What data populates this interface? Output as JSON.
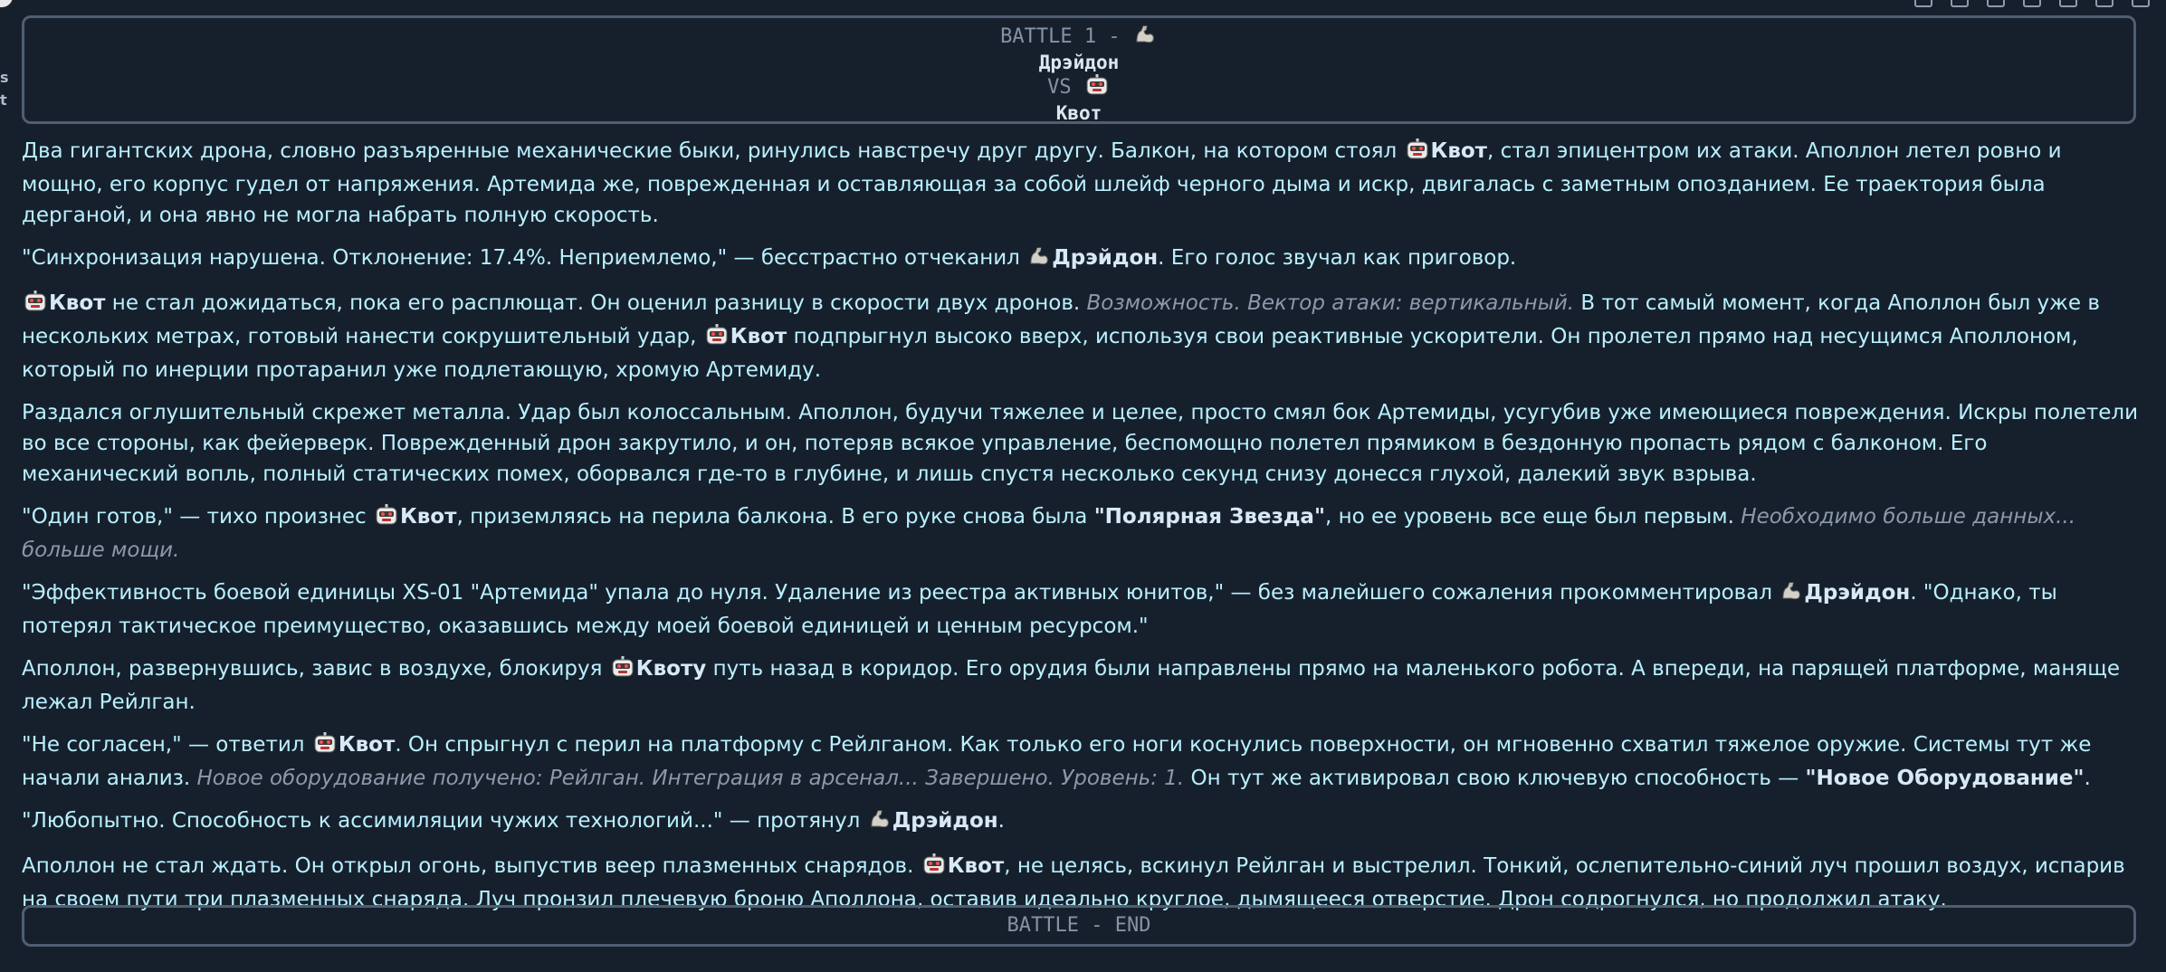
{
  "left_fragments": [
    "s",
    "t"
  ],
  "header": {
    "title": "BATTLE 1 -",
    "fighter_1": "Дрэйдон",
    "vs": "VS",
    "fighter_2": "Квот"
  },
  "footer_label": "BATTLE - END",
  "icons": {
    "muscle": "flexed-biceps-icon",
    "robot": "robot-face-icon"
  },
  "paragraphs": [
    [
      {
        "t": "Два гигантских дрона, словно разъяренные механические быки, ринулись навстречу друг другу. Балкон, на котором стоял "
      },
      {
        "icon": "robot"
      },
      {
        "t": "Квот",
        "s": "b"
      },
      {
        "t": ", стал эпицентром их атаки. Аполлон летел ровно и мощно, его корпус гудел от напряжения. Артемида же, поврежденная и оставляющая за собой шлейф черного дыма и искр, двигалась с заметным опозданием. Ее траектория была дерганой, и она явно не могла набрать полную скорость."
      }
    ],
    [
      {
        "t": "\"Синхронизация нарушена. Отклонение: 17.4%. Неприемлемо,\" — бесстрастно отчеканил "
      },
      {
        "icon": "muscle"
      },
      {
        "t": "Дрэйдон",
        "s": "b"
      },
      {
        "t": ". Его голос звучал как приговор."
      }
    ],
    [
      {
        "icon": "robot"
      },
      {
        "t": "Квот",
        "s": "b"
      },
      {
        "t": " не стал дожидаться, пока его расплющат. Он оценил разницу в скорости двух дронов. "
      },
      {
        "t": "Возможность. Вектор атаки: вертикальный.",
        "s": "i"
      },
      {
        "t": " В тот самый момент, когда Аполлон был уже в нескольких метрах, готовый нанести сокрушительный удар, "
      },
      {
        "icon": "robot"
      },
      {
        "t": "Квот",
        "s": "b"
      },
      {
        "t": " подпрыгнул высоко вверх, используя свои реактивные ускорители. Он пролетел прямо над несущимся Аполлоном, который по инерции протаранил уже подлетающую, хромую Артемиду."
      }
    ],
    [
      {
        "t": "Раздался оглушительный скрежет металла. Удар был колоссальным. Аполлон, будучи тяжелее и целее, просто смял бок Артемиды, усугубив уже имеющиеся повреждения. Искры полетели во все стороны, как фейерверк. Поврежденный дрон закрутило, и он, потеряв всякое управление, беспомощно полетел прямиком в бездонную пропасть рядом с балконом. Его механический вопль, полный статических помех, оборвался где-то в глубине, и лишь спустя несколько секунд снизу донесся глухой, далекий звук взрыва."
      }
    ],
    [
      {
        "t": "\"Один готов,\" — тихо произнес "
      },
      {
        "icon": "robot"
      },
      {
        "t": "Квот",
        "s": "b"
      },
      {
        "t": ", приземляясь на перила балкона. В его руке снова была "
      },
      {
        "t": "\"Полярная Звезда\"",
        "s": "b"
      },
      {
        "t": ", но ее уровень все еще был первым. "
      },
      {
        "t": "Необходимо больше данных... больше мощи.",
        "s": "i"
      }
    ],
    [
      {
        "t": "\"Эффективность боевой единицы XS-01 \"Артемида\" упала до нуля. Удаление из реестра активных юнитов,\" — без малейшего сожаления прокомментировал "
      },
      {
        "icon": "muscle"
      },
      {
        "t": "Дрэйдон",
        "s": "b"
      },
      {
        "t": ". \"Однако, ты потерял тактическое преимущество, оказавшись между моей боевой единицей и ценным ресурсом.\""
      }
    ],
    [
      {
        "t": "Аполлон, развернувшись, завис в воздухе, блокируя "
      },
      {
        "icon": "robot"
      },
      {
        "t": "Квоту",
        "s": "b"
      },
      {
        "t": " путь назад в коридор. Его орудия были направлены прямо на маленького робота. А впереди, на парящей платформе, маняще лежал Рейлган."
      }
    ],
    [
      {
        "t": "\"Не согласен,\" — ответил "
      },
      {
        "icon": "robot"
      },
      {
        "t": "Квот",
        "s": "b"
      },
      {
        "t": ". Он спрыгнул с перил на платформу с Рейлганом. Как только его ноги коснулись поверхности, он мгновенно схватил тяжелое оружие. Системы тут же начали анализ. "
      },
      {
        "t": "Новое оборудование получено: Рейлган. Интеграция в арсенал... Завершено. Уровень: 1.",
        "s": "i"
      },
      {
        "t": " Он тут же активировал свою ключевую способность — "
      },
      {
        "t": "\"Новое Оборудование\"",
        "s": "b"
      },
      {
        "t": "."
      }
    ],
    [
      {
        "t": "\"Любопытно. Способность к ассимиляции чужих технологий...\" — протянул "
      },
      {
        "icon": "muscle"
      },
      {
        "t": "Дрэйдон",
        "s": "b"
      },
      {
        "t": "."
      }
    ],
    [
      {
        "t": "Аполлон не стал ждать. Он открыл огонь, выпустив веер плазменных снарядов. "
      },
      {
        "icon": "robot"
      },
      {
        "t": "Квот",
        "s": "b"
      },
      {
        "t": ", не целясь, вскинул Рейлган и выстрелил. Тонкий, ослепительно-синий луч прошил воздух, испарив на своем пути три плазменных снаряда. Луч пронзил плечевую броню Аполлона, оставив идеально круглое, дымящееся отверстие. Дрон содрогнулся, но продолжил атаку."
      }
    ]
  ]
}
